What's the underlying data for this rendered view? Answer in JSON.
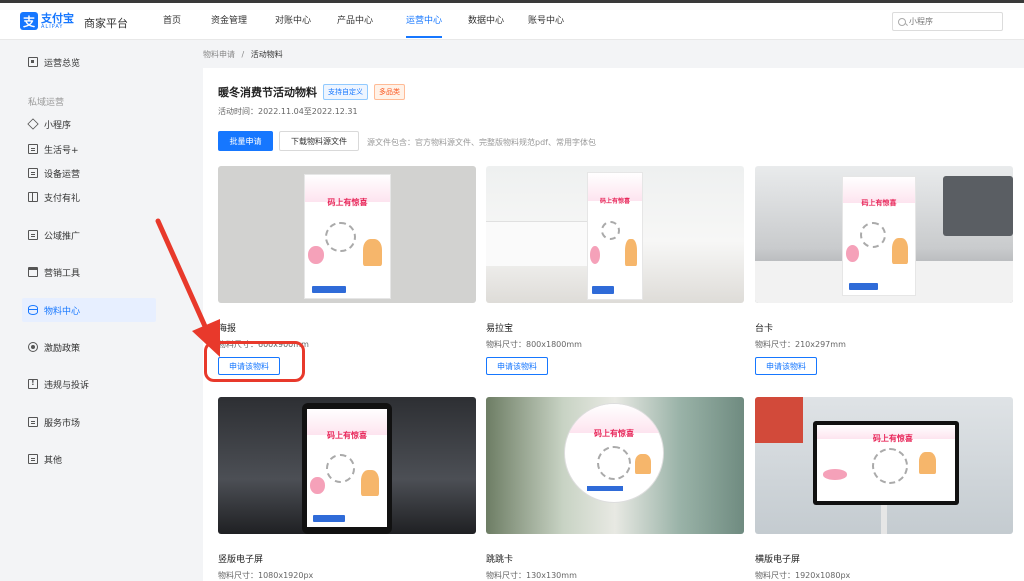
{
  "header": {
    "logo_cn": "支付宝",
    "logo_en": "ALIPAY",
    "platform": "商家平台",
    "nav": [
      "首页",
      "资金管理",
      "对账中心",
      "产品中心",
      "运营中心",
      "数据中心",
      "账号中心"
    ],
    "active_nav": "运营中心",
    "search_placeholder": "小程序"
  },
  "sidebar": {
    "top_item": "运营总览",
    "group_label": "私域运营",
    "items": [
      "小程序",
      "生活号+",
      "设备运营",
      "支付有礼",
      "公域推广",
      "营销工具",
      "物料中心",
      "激励政策",
      "违规与投诉",
      "服务市场",
      "其他"
    ],
    "active": "物料中心"
  },
  "breadcrumb": {
    "parent": "物料申请",
    "sep": "/",
    "current": "活动物料"
  },
  "activity": {
    "title": "暖冬消费节活动物料",
    "tags": [
      "支持自定义",
      "多品类"
    ],
    "time": "活动时间：2022.11.04至2022.12.31",
    "batch_button": "批量申请",
    "download_button": "下载物料源文件",
    "source_note": "源文件包含：官方物料源文件、完整版物料规范pdf、常用字体包"
  },
  "poster_headline": "码上有惊喜",
  "cards": [
    {
      "name": "海报",
      "size": "物料尺寸：600x900mm",
      "button": "申请该物料"
    },
    {
      "name": "易拉宝",
      "size": "物料尺寸：800x1800mm",
      "button": "申请该物料"
    },
    {
      "name": "台卡",
      "size": "物料尺寸：210x297mm",
      "button": "申请该物料"
    },
    {
      "name": "竖版电子屏",
      "size": "物料尺寸：1080x1920px",
      "button": ""
    },
    {
      "name": "跳跳卡",
      "size": "物料尺寸：130x130mm",
      "button": ""
    },
    {
      "name": "横版电子屏",
      "size": "物料尺寸：1920x1080px",
      "button": ""
    }
  ],
  "colors": {
    "primary": "#1677ff",
    "annotation": "#e8392b",
    "active_bg": "#e7efff"
  }
}
